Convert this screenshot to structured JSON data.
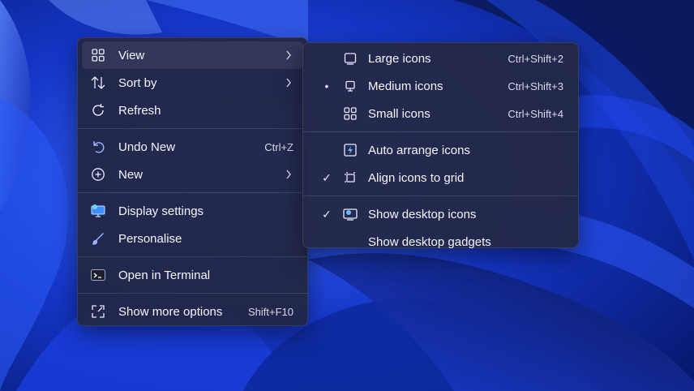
{
  "main_menu": {
    "items": [
      {
        "label": "View",
        "icon": "grid-four-icon",
        "submenu": true
      },
      {
        "label": "Sort by",
        "icon": "sort-arrows-icon",
        "submenu": true
      },
      {
        "label": "Refresh",
        "icon": "refresh-icon"
      },
      {
        "label": "Undo New",
        "icon": "undo-icon",
        "shortcut": "Ctrl+Z"
      },
      {
        "label": "New",
        "icon": "plus-circle-icon",
        "submenu": true
      },
      {
        "label": "Display settings",
        "icon": "monitor-settings-icon"
      },
      {
        "label": "Personalise",
        "icon": "brush-icon"
      },
      {
        "label": "Open in Terminal",
        "icon": "terminal-icon"
      },
      {
        "label": "Show more options",
        "icon": "expand-icon",
        "shortcut": "Shift+F10"
      }
    ]
  },
  "view_submenu": {
    "items": [
      {
        "label": "Large icons",
        "icon": "large-icons-icon",
        "shortcut": "Ctrl+Shift+2",
        "mark": ""
      },
      {
        "label": "Medium icons",
        "icon": "medium-icons-icon",
        "shortcut": "Ctrl+Shift+3",
        "mark": "•"
      },
      {
        "label": "Small icons",
        "icon": "small-icons-icon",
        "shortcut": "Ctrl+Shift+4",
        "mark": ""
      },
      {
        "label": "Auto arrange icons",
        "icon": "auto-arrange-icon",
        "mark": ""
      },
      {
        "label": "Align icons to grid",
        "icon": "align-grid-icon",
        "mark": "✓"
      },
      {
        "label": "Show desktop icons",
        "icon": "desktop-icons-icon",
        "mark": "✓"
      },
      {
        "label": "Show desktop gadgets",
        "icon": "",
        "mark": ""
      }
    ]
  },
  "colors": {
    "menu_bg": "#222642",
    "text": "#f4f6ff",
    "wallpaper_deep": "#061a6e",
    "wallpaper_bright": "#2c5bff"
  }
}
